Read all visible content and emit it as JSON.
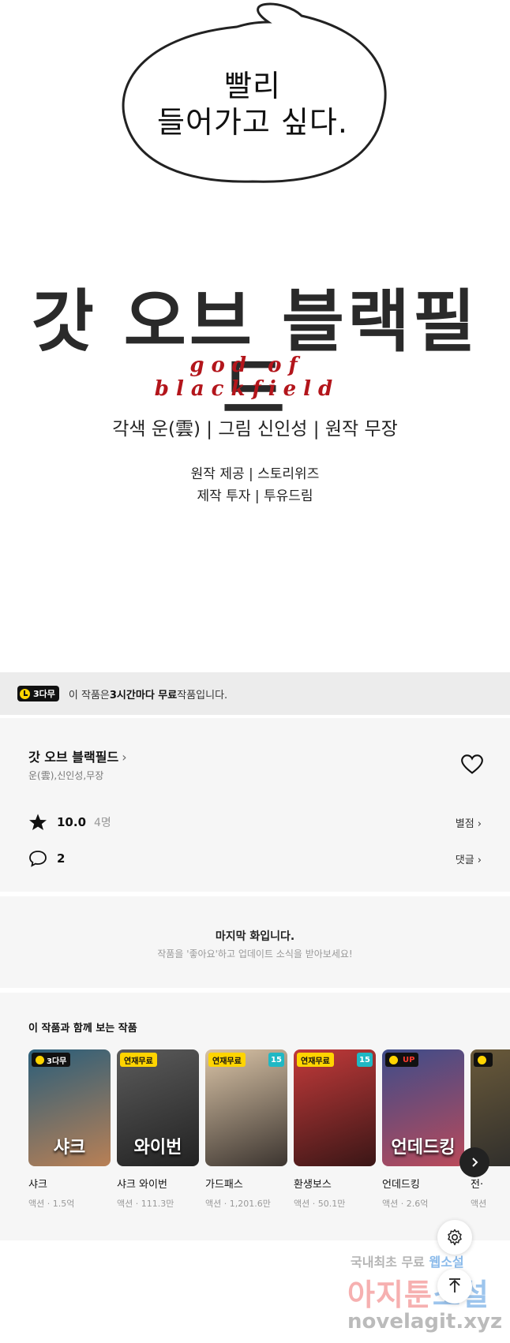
{
  "panel": {
    "bubble_lines": [
      "빨리",
      "들어가고 싶다."
    ],
    "logo_kr": "갓 오브 블랙필드",
    "logo_en": "god of blackfield",
    "credit_main": "각색 운(雲) | 그림 신인성 | 원작 무장",
    "credit_sub": [
      "원작 제공 | 스토리위즈",
      "제작 투자 | 투유드림"
    ]
  },
  "free_banner": {
    "badge": "3다무",
    "text_pre": "이 작품은 ",
    "text_bold": "3시간마다 무료",
    "text_post": " 작품입니다."
  },
  "info": {
    "title": "갓 오브 블랙필드",
    "authors": "운(雲),신인성,무장",
    "rating": "10.0",
    "rating_count": "4명",
    "rating_link": "별점 ›",
    "comments": "2",
    "comments_link": "댓글 ›"
  },
  "last_episode": {
    "title": "마지막 화입니다.",
    "subtitle": "작품을 '좋아요'하고 업데이트 소식을 받아보세요!"
  },
  "recommendations": {
    "title": "이 작품과 함께 보는 작품",
    "items": [
      {
        "tag": "3다무",
        "tag_kind": "dark",
        "age": "",
        "art": "샤크",
        "title": "샤크",
        "meta": "액션 · 1.5억",
        "c1": "#2a5e7a",
        "c2": "#b98055"
      },
      {
        "tag": "연재무료",
        "tag_kind": "free",
        "age": "",
        "art": "와이번",
        "title": "샤크 와이번",
        "meta": "액션 · 111.3만",
        "c1": "#5b5b5b",
        "c2": "#222222"
      },
      {
        "tag": "연재무료",
        "tag_kind": "free",
        "age": "15",
        "art": "",
        "title": "가드패스",
        "meta": "액션 · 1,201.6만",
        "c1": "#d9c3a6",
        "c2": "#3c3530"
      },
      {
        "tag": "연재무료",
        "tag_kind": "free",
        "age": "15",
        "art": "",
        "title": "환생보스",
        "meta": "액션 · 50.1만",
        "c1": "#c23a3a",
        "c2": "#3a1616"
      },
      {
        "tag": "UP",
        "tag_kind": "up",
        "age": "",
        "art": "언데드킹",
        "title": "언데드킹",
        "meta": "액션 · 2.6억",
        "c1": "#3d4c8a",
        "c2": "#b94a5a"
      },
      {
        "tag": "",
        "tag_kind": "dark",
        "age": "",
        "art": "",
        "title": "전·",
        "meta": "액션",
        "c1": "#6a5a3a",
        "c2": "#2a2a2a"
      }
    ]
  },
  "watermark": {
    "line1_a": "국내최초 무료 ",
    "line1_b": "웹소설",
    "line2_a": "아지툰",
    "line2_b": "소설",
    "line3": "novelagit.xyz"
  },
  "colors": {
    "accent_yellow": "#ffd400",
    "age_badge": "#1fb8c4",
    "logo_red": "#b3151b"
  },
  "icons": [
    "clock-icon",
    "chevron-right-icon",
    "heart-icon",
    "star-icon",
    "comment-icon",
    "arrow-right-icon",
    "gear-icon",
    "arrow-up-icon"
  ]
}
